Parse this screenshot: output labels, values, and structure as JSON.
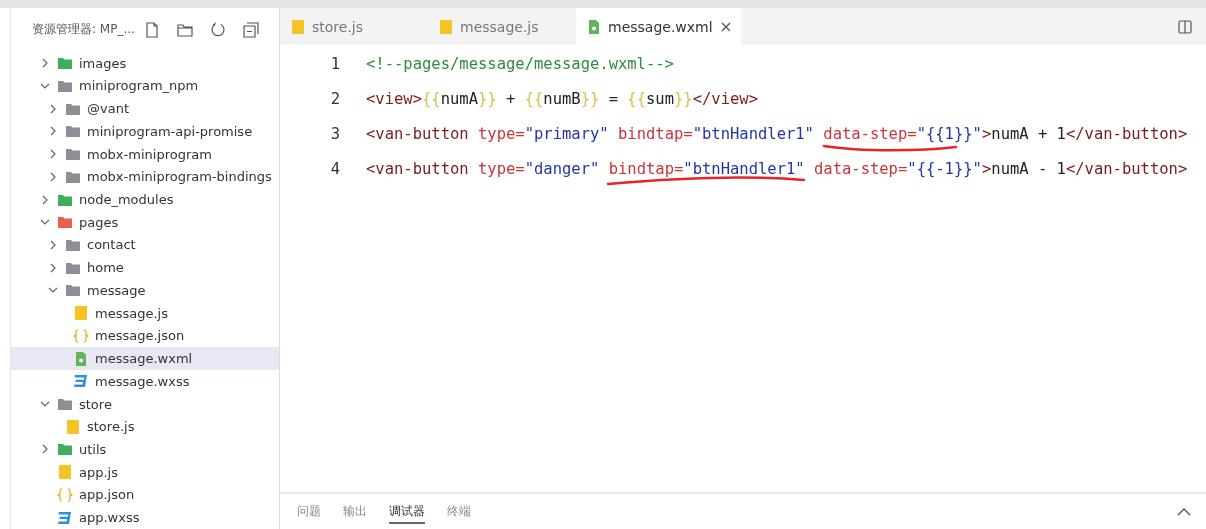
{
  "explorer": {
    "title": "资源管理器: MP_...",
    "tree": [
      {
        "name": "images",
        "kind": "folder-green",
        "expanded": false,
        "selected": false
      },
      {
        "name": "miniprogram_npm",
        "kind": "folder",
        "expanded": true,
        "selected": false,
        "children": [
          {
            "name": "@vant",
            "kind": "folder",
            "expanded": false,
            "selected": false
          },
          {
            "name": "miniprogram-api-promise",
            "kind": "folder",
            "expanded": false,
            "selected": false
          },
          {
            "name": "mobx-miniprogram",
            "kind": "folder",
            "expanded": false,
            "selected": false
          },
          {
            "name": "mobx-miniprogram-bindings",
            "kind": "folder",
            "expanded": false,
            "selected": false
          }
        ]
      },
      {
        "name": "node_modules",
        "kind": "folder-green",
        "expanded": false,
        "selected": false
      },
      {
        "name": "pages",
        "kind": "folder-red",
        "expanded": true,
        "selected": false,
        "children": [
          {
            "name": "contact",
            "kind": "folder",
            "expanded": false,
            "selected": false
          },
          {
            "name": "home",
            "kind": "folder",
            "expanded": false,
            "selected": false
          },
          {
            "name": "message",
            "kind": "folder",
            "expanded": true,
            "selected": false,
            "children": [
              {
                "name": "message.js",
                "kind": "js",
                "selected": false
              },
              {
                "name": "message.json",
                "kind": "json",
                "selected": false
              },
              {
                "name": "message.wxml",
                "kind": "wxml",
                "selected": true
              },
              {
                "name": "message.wxss",
                "kind": "wxss",
                "selected": false
              }
            ]
          }
        ]
      },
      {
        "name": "store",
        "kind": "folder",
        "expanded": true,
        "selected": false,
        "children": [
          {
            "name": "store.js",
            "kind": "js",
            "selected": false
          }
        ]
      },
      {
        "name": "utils",
        "kind": "folder-green",
        "expanded": false,
        "selected": false
      },
      {
        "name": "app.js",
        "kind": "js",
        "selected": false
      },
      {
        "name": "app.json",
        "kind": "json",
        "selected": false
      },
      {
        "name": "app.wxss",
        "kind": "wxss",
        "selected": false
      }
    ]
  },
  "tabs": [
    {
      "label": "store.js",
      "kind": "js",
      "selected": false
    },
    {
      "label": "message.js",
      "kind": "js",
      "selected": false
    },
    {
      "label": "message.wxml",
      "kind": "wxml",
      "selected": true
    }
  ],
  "code": [
    {
      "number": "1",
      "tokens": [
        {
          "kind": "comment",
          "text": "<!--pages/message/message.wxml-->"
        }
      ]
    },
    {
      "number": "2",
      "tokens": [
        {
          "kind": "tag",
          "text": "<view>"
        },
        {
          "kind": "brace",
          "text": "{{"
        },
        {
          "kind": "plain",
          "text": "numA"
        },
        {
          "kind": "brace",
          "text": "}}"
        },
        {
          "kind": "plain",
          "text": " + "
        },
        {
          "kind": "brace",
          "text": "{{"
        },
        {
          "kind": "plain",
          "text": "numB"
        },
        {
          "kind": "brace",
          "text": "}}"
        },
        {
          "kind": "plain",
          "text": " = "
        },
        {
          "kind": "brace",
          "text": "{{"
        },
        {
          "kind": "plain",
          "text": "sum"
        },
        {
          "kind": "brace",
          "text": "}}"
        },
        {
          "kind": "tag",
          "text": "</view>"
        }
      ]
    },
    {
      "number": "3",
      "tokens": [
        {
          "kind": "tag",
          "text": "<van-button "
        },
        {
          "kind": "attr",
          "text": "type="
        },
        {
          "kind": "string",
          "text": "\"primary\" "
        },
        {
          "kind": "attr",
          "text": "bindtap="
        },
        {
          "kind": "string",
          "text": "\"btnHandler1\" "
        },
        {
          "kind": "attr",
          "text": "data-step="
        },
        {
          "kind": "string",
          "text": "\"{{1}}\""
        },
        {
          "kind": "tag",
          "text": ">"
        },
        {
          "kind": "plain",
          "text": "numA + 1"
        },
        {
          "kind": "tag",
          "text": "</van-button>"
        }
      ]
    },
    {
      "number": "4",
      "tokens": [
        {
          "kind": "tag",
          "text": "<van-button "
        },
        {
          "kind": "attr",
          "text": "type="
        },
        {
          "kind": "string",
          "text": "\"danger\" "
        },
        {
          "kind": "attr",
          "text": "bindtap="
        },
        {
          "kind": "string",
          "text": "\"btnHandler1\" "
        },
        {
          "kind": "attr",
          "text": "data-step="
        },
        {
          "kind": "string",
          "text": "\"{{-1}}\""
        },
        {
          "kind": "tag",
          "text": ">"
        },
        {
          "kind": "plain",
          "text": "numA - 1"
        },
        {
          "kind": "tag",
          "text": "</van-button>"
        }
      ]
    }
  ],
  "panel_tabs": [
    {
      "label": "问题",
      "selected": false
    },
    {
      "label": "输出",
      "selected": false
    },
    {
      "label": "调试器",
      "selected": true
    },
    {
      "label": "终端",
      "selected": false
    }
  ]
}
